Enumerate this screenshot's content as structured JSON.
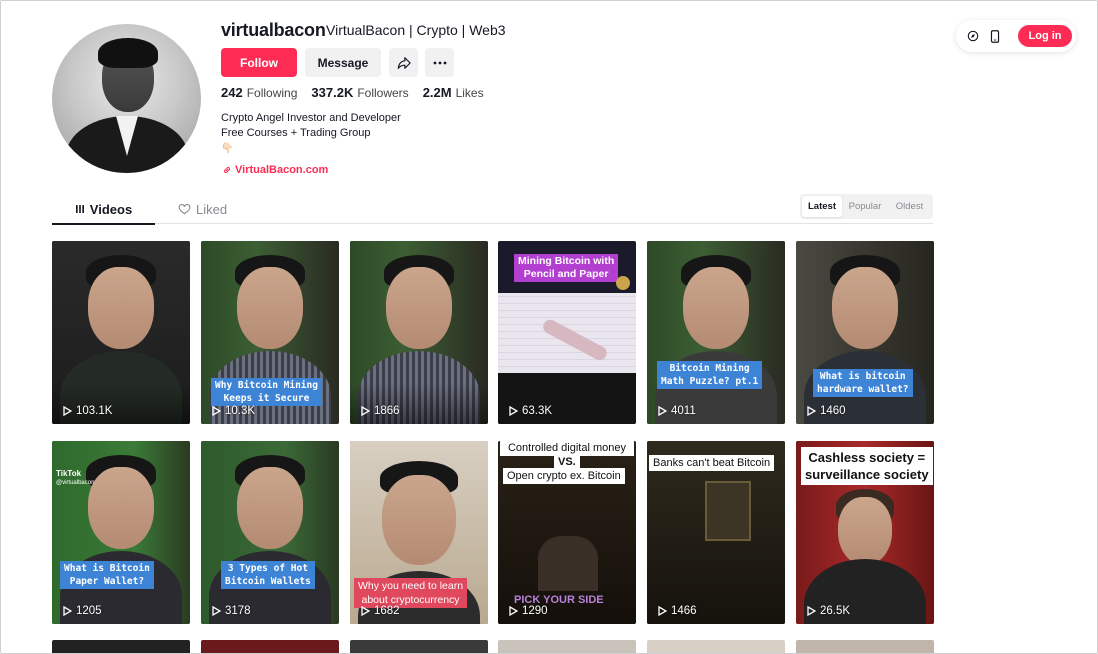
{
  "profile": {
    "username": "virtualbacon",
    "nickname": "VirtualBacon | Crypto | Web3",
    "follow_label": "Follow",
    "message_label": "Message",
    "following_count": "242",
    "following_label": "Following",
    "followers_count": "337.2K",
    "followers_label": "Followers",
    "likes_count": "2.2M",
    "likes_label": "Likes",
    "bio_line1": "Crypto Angel Investor and Developer",
    "bio_line2": "Free Courses + Trading Group",
    "bio_line3": "👇🏻",
    "link": "VirtualBacon.com"
  },
  "top_bar": {
    "login_label": "Log in"
  },
  "tabs": {
    "videos": "Videos",
    "liked": "Liked"
  },
  "sort": {
    "latest": "Latest",
    "popular": "Popular",
    "oldest": "Oldest"
  },
  "videos": [
    {
      "views": "103.1K"
    },
    {
      "views": "10.3K",
      "caption": "Why Bitcoin Mining\nKeeps it Secure"
    },
    {
      "views": "1866"
    },
    {
      "views": "63.3K",
      "caption": "Mining Bitcoin with\nPencil and Paper"
    },
    {
      "views": "4011",
      "caption": "Bitcoin Mining\nMath Puzzle? pt.1"
    },
    {
      "views": "1460",
      "caption": "What is bitcoin\nhardware wallet?"
    },
    {
      "views": "1205",
      "caption": "What is Bitcoin\nPaper Wallet?",
      "watermark": "TikTok",
      "handle": "@virtualbacon"
    },
    {
      "views": "3178",
      "caption": "3 Types of Hot\nBitcoin Wallets"
    },
    {
      "views": "1682",
      "caption": "Why you need to learn\nabout cryptocurrency"
    },
    {
      "views": "1290",
      "caption_top": "Controlled digital money",
      "caption_mid": "VS.",
      "caption_bot": "Open crypto ex. Bitcoin",
      "caption_footer": "PICK YOUR SIDE"
    },
    {
      "views": "1466",
      "caption": "Banks can't beat Bitcoin"
    },
    {
      "views": "26.5K",
      "caption": "Cashless society =\nsurveillance society"
    }
  ],
  "colors": {
    "accent": "#fe2c55",
    "caption_blue": "#3d84d6",
    "caption_pink": "#b23fd0"
  }
}
